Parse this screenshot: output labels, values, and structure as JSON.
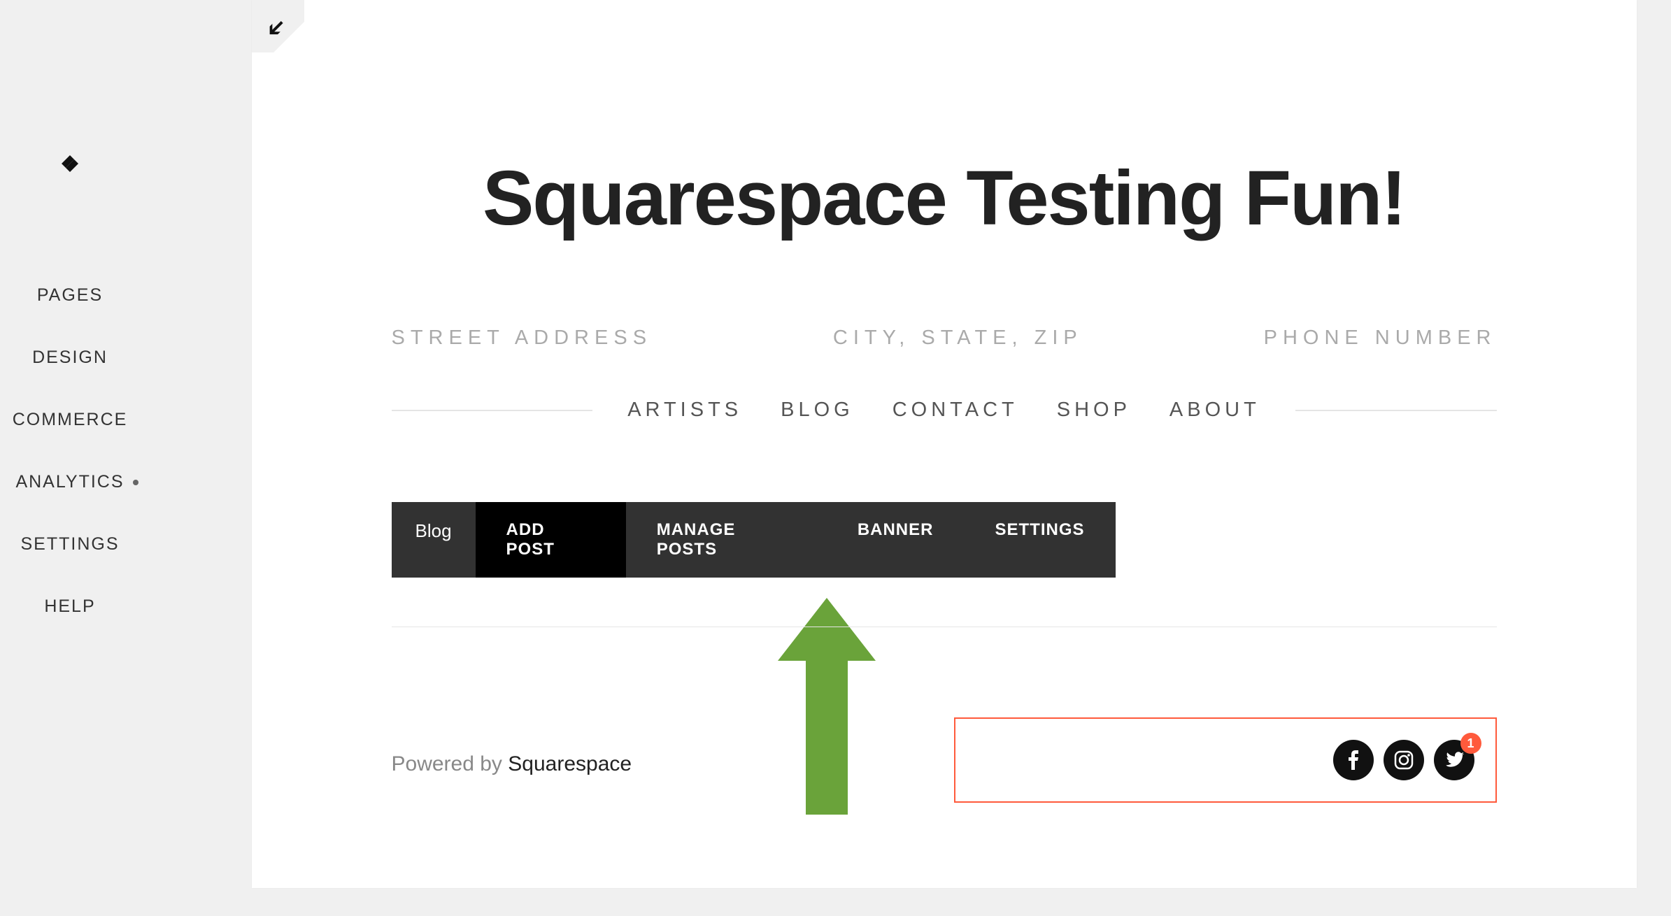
{
  "sidebar": {
    "items": [
      {
        "label": "PAGES"
      },
      {
        "label": "DESIGN"
      },
      {
        "label": "COMMERCE"
      },
      {
        "label": "ANALYTICS",
        "has_indicator": true
      },
      {
        "label": "SETTINGS"
      },
      {
        "label": "HELP"
      }
    ]
  },
  "site": {
    "title": "Squarespace Testing Fun!",
    "info": {
      "street": "STREET ADDRESS",
      "city": "CITY, STATE, ZIP",
      "phone": "PHONE NUMBER"
    },
    "nav": [
      "ARTISTS",
      "BLOG",
      "CONTACT",
      "SHOP",
      "ABOUT"
    ]
  },
  "toolbar": {
    "page_label": "Blog",
    "actions": [
      {
        "label": "ADD POST",
        "active": true
      },
      {
        "label": "MANAGE POSTS"
      },
      {
        "label": "BANNER"
      },
      {
        "label": "SETTINGS"
      }
    ]
  },
  "footer": {
    "powered_prefix": "Powered by ",
    "powered_brand": "Squarespace",
    "social": {
      "badge_count": "1"
    }
  },
  "annotation": {
    "arrow_color": "#6aa33a"
  }
}
